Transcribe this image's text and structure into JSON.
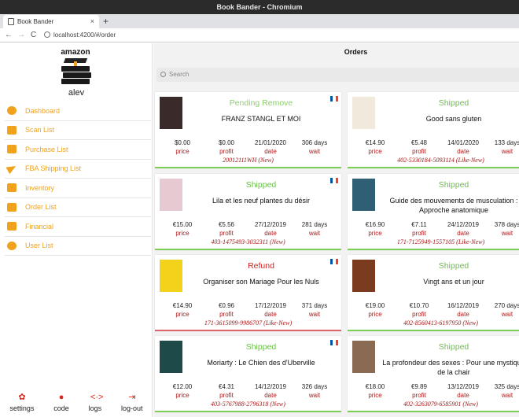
{
  "window": {
    "title": "Book Bander - Chromium"
  },
  "browser": {
    "tab_title": "Book Bander",
    "tab_close": "×",
    "new_tab": "+",
    "back": "←",
    "forward": "→",
    "reload": "C",
    "url": "localhost:4200/#/order"
  },
  "sidebar": {
    "brand": "amazon",
    "username": "alev",
    "items": [
      {
        "label": "Dashboard",
        "icon": "dashboard-icon"
      },
      {
        "label": "Scan List",
        "icon": "scan-icon"
      },
      {
        "label": "Purchase List",
        "icon": "basket-icon"
      },
      {
        "label": "FBA Shipping List",
        "icon": "paper-plane-icon"
      },
      {
        "label": "Inventory",
        "icon": "books-icon"
      },
      {
        "label": "Order List",
        "icon": "basket-icon"
      },
      {
        "label": "Financial",
        "icon": "wallet-icon"
      },
      {
        "label": "User List",
        "icon": "users-icon"
      }
    ],
    "bottom": [
      {
        "label": "settings",
        "icon": "gear-icon",
        "glyph": "✿"
      },
      {
        "label": "code",
        "icon": "user-icon",
        "glyph": "●"
      },
      {
        "label": "logs",
        "icon": "code-icon",
        "glyph": "<·>"
      },
      {
        "label": "log-out",
        "icon": "logout-icon",
        "glyph": "⇥"
      }
    ]
  },
  "main": {
    "title": "Orders",
    "search_placeholder": "Search",
    "stat_labels": {
      "price": "price",
      "profit": "profit",
      "date": "date",
      "wait": "wait"
    },
    "orders": [
      {
        "status": "Pending Remove",
        "status_type": "pending",
        "title": "FRANZ STANGL ET MOI",
        "flag": true,
        "price": "$0.00",
        "profit": "$0.00",
        "date": "21/01/2020",
        "wait": "306 days",
        "order_id": "20012111WH (New)",
        "cover_color": "#3a2a2a"
      },
      {
        "status": "Shipped",
        "status_type": "shipped",
        "title": "Good sans gluten",
        "flag": false,
        "price": "€14.90",
        "profit": "€5.48",
        "date": "14/01/2020",
        "wait": "133 days",
        "order_id": "402-5330184-5093114 (Like-New)",
        "cover_color": "#f1e9dc"
      },
      {
        "status": "Shipped",
        "status_type": "shipped",
        "title": "Lila et les neuf plantes du désir",
        "flag": true,
        "price": "€15.00",
        "profit": "€5.56",
        "date": "27/12/2019",
        "wait": "281 days",
        "order_id": "403-1475493-3032311 (New)",
        "cover_color": "#e7c9d2"
      },
      {
        "status": "Shipped",
        "status_type": "shipped",
        "title": "Guide des mouvements de musculation : Approche anatomique",
        "flag": true,
        "price": "€16.90",
        "profit": "€7.11",
        "date": "24/12/2019",
        "wait": "378 days",
        "order_id": "171-7125949-1557105 (Like-New)",
        "cover_color": "#2f5f74"
      },
      {
        "status": "Refund",
        "status_type": "refund",
        "title": "Organiser son Mariage Pour les Nuls",
        "flag": true,
        "price": "€14.90",
        "profit": "€0.96",
        "date": "17/12/2019",
        "wait": "371 days",
        "order_id": "171-3615099-9986707 (Like-New)",
        "cover_color": "#f2d21b"
      },
      {
        "status": "Shipped",
        "status_type": "shipped",
        "title": "Vingt ans et un jour",
        "flag": false,
        "price": "€19.00",
        "profit": "€10.70",
        "date": "16/12/2019",
        "wait": "270 days",
        "order_id": "402-8560413-6197950 (New)",
        "cover_color": "#7a3b1e"
      },
      {
        "status": "Shipped",
        "status_type": "shipped",
        "title": "Moriarty : Le Chien des d'Uberville",
        "flag": true,
        "price": "€12.00",
        "profit": "€4.31",
        "date": "14/12/2019",
        "wait": "326 days",
        "order_id": "403-5767988-2796318 (New)",
        "cover_color": "#1f4a4a"
      },
      {
        "status": "Shipped",
        "status_type": "shipped",
        "title": "La profondeur des sexes : Pour une mystique de la chair",
        "flag": false,
        "price": "€18.00",
        "profit": "€9.89",
        "date": "13/12/2019",
        "wait": "325 days",
        "order_id": "402-3263079-6585901 (New)",
        "cover_color": "#8a6a52"
      }
    ]
  },
  "colors": {
    "accent": "#f0a21c",
    "shipped": "#6cc04a",
    "refund": "#d62020",
    "order_id": "#a31515"
  }
}
